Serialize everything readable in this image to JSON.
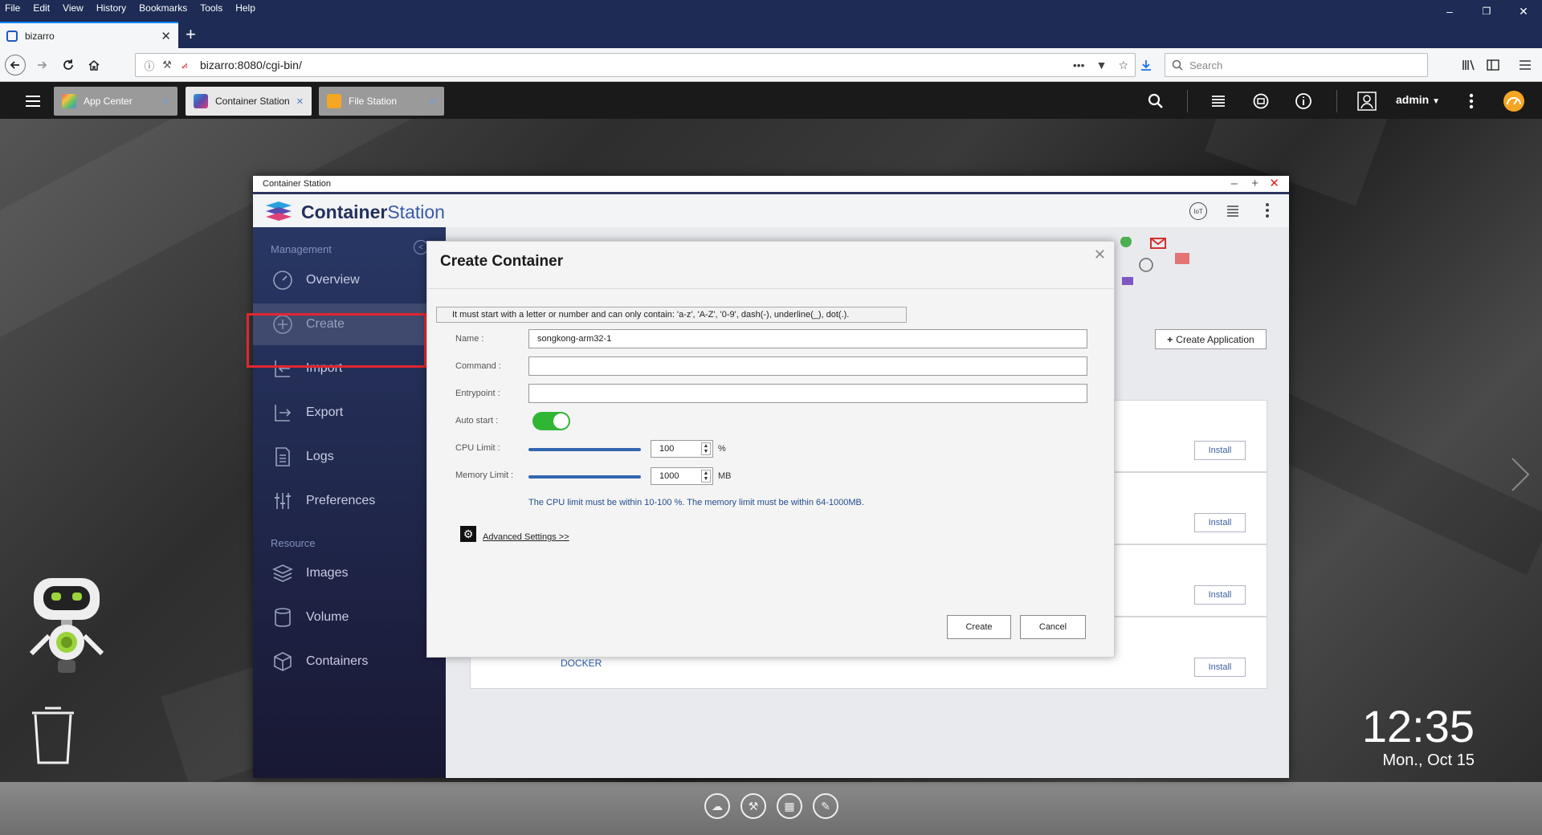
{
  "firefox": {
    "menu": [
      "File",
      "Edit",
      "View",
      "History",
      "Bookmarks",
      "Tools",
      "Help"
    ],
    "tab_title": "bizarro",
    "url": "bizarro:8080/cgi-bin/",
    "search_placeholder": "Search"
  },
  "qts": {
    "tabs": [
      {
        "label": "App Center",
        "icon_color": "#f0a030"
      },
      {
        "label": "Container Station",
        "icon_color": "#5a4bb0"
      },
      {
        "label": "File Station",
        "icon_color": "#f5a623"
      }
    ],
    "user": "admin",
    "clock": "12:35",
    "date": "Mon., Oct 15"
  },
  "window": {
    "title": "Container Station",
    "logo_bold": "Container",
    "logo_light": "Station"
  },
  "sidebar": {
    "section1": "Management",
    "section2": "Resource",
    "items": [
      {
        "label": "Overview",
        "icon": "gauge-icon"
      },
      {
        "label": "Create",
        "icon": "plus-circle-icon"
      },
      {
        "label": "Import",
        "icon": "import-icon"
      },
      {
        "label": "Export",
        "icon": "export-icon"
      },
      {
        "label": "Logs",
        "icon": "document-icon"
      },
      {
        "label": "Preferences",
        "icon": "sliders-icon"
      },
      {
        "label": "Images",
        "icon": "layers-icon"
      },
      {
        "label": "Volume",
        "icon": "cylinder-icon"
      },
      {
        "label": "Containers",
        "icon": "cube-icon"
      }
    ]
  },
  "main": {
    "create_application": "Create Application",
    "install_label": "Install",
    "card4_label": "DOCKER"
  },
  "modal": {
    "title": "Create Container",
    "hint": "It must start with a letter or number and can only contain: 'a-z', 'A-Z', '0-9', dash(-), underline(_), dot(.).",
    "labels": {
      "name": "Name :",
      "command": "Command :",
      "entrypoint": "Entrypoint :",
      "auto_start": "Auto start :",
      "cpu_limit": "CPU Limit :",
      "memory_limit": "Memory Limit :"
    },
    "values": {
      "name": "songkong-arm32-1",
      "command": "",
      "entrypoint": "",
      "auto_start": true,
      "cpu_limit": "100",
      "cpu_unit": "%",
      "memory_limit": "1000",
      "memory_unit": "MB"
    },
    "limit_note": "The CPU limit must be within 10-100 %. The memory limit must be within 64-1000MB.",
    "advanced": "Advanced Settings >>",
    "create_button": "Create",
    "cancel_button": "Cancel"
  },
  "colors": {
    "firefox_chrome": "#1d2b55",
    "sidebar": "#283764",
    "toggle_on": "#2fb635",
    "highlight": "#e2262f"
  }
}
